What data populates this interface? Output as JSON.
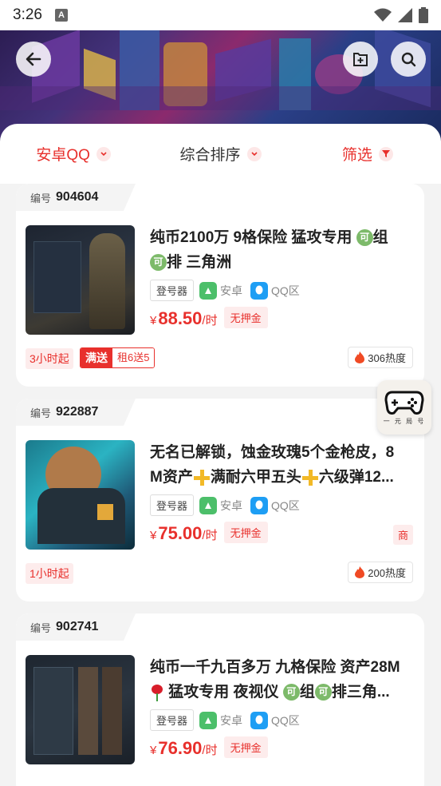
{
  "status_bar": {
    "time": "3:26",
    "notification_icon": "A"
  },
  "header": {
    "back_icon": "back-arrow-icon",
    "share_icon": "add-to-desktop-icon",
    "search_icon": "search-icon"
  },
  "filters": [
    {
      "label": "安卓QQ"
    },
    {
      "label": "综合排序"
    },
    {
      "label": "筛选"
    }
  ],
  "listings": [
    {
      "id_label": "编号",
      "id": "904604",
      "title_line1": "纯币2100万 9格保险 猛攻专用 ",
      "title_line1b": "组",
      "title_line2": "排 三角洲",
      "badge_ke": "可",
      "login": "登号器",
      "platform": "安卓",
      "region": "QQ区",
      "currency": "¥",
      "price": "88.50",
      "unit": "/时",
      "no_deposit": "无押金",
      "min_rent": "3小时起",
      "promo_badge": "满送",
      "promo_detail": "租6送5",
      "heat": "306热度"
    },
    {
      "id_label": "编号",
      "id": "922887",
      "title_line1": "无名已解锁，蚀金玫瑰5个金枪皮，8",
      "title_line2a": "M资产",
      "title_line2b": "满耐六甲五头",
      "title_line2c": "六级弹12...",
      "login": "登号器",
      "platform": "安卓",
      "region": "QQ区",
      "currency": "¥",
      "price": "75.00",
      "unit": "/时",
      "no_deposit": "无押金",
      "shop_badge": "商",
      "min_rent": "1小时起",
      "heat": "200热度"
    },
    {
      "id_label": "编号",
      "id": "902741",
      "title_line1": "纯币一千九百多万 九格保险 资产28M",
      "title_line2a": " 猛攻专用 夜视仪 ",
      "title_line2b": "组",
      "title_line2c": "排三角...",
      "badge_ke": "可",
      "login": "登号器",
      "platform": "安卓",
      "region": "QQ区",
      "currency": "¥",
      "price": "76.90",
      "unit": "/时",
      "no_deposit": "无押金"
    }
  ],
  "fab": {
    "caption": "一 元 局 号",
    "icon": "gamepad-icon"
  },
  "colors": {
    "accent": "#e8302c",
    "tag_bg": "#fdecec",
    "android_green": "#4cbf6a",
    "qq_blue": "#1e9ef4"
  }
}
